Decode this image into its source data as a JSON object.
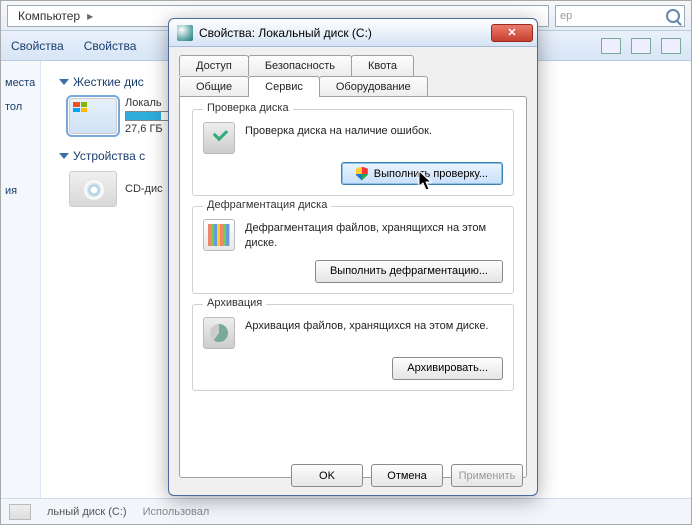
{
  "explorer": {
    "breadcrumb_root": "Компьютер",
    "search_placeholder": "ер",
    "toolbar": {
      "props1": "Свойства",
      "props2": "Свойства"
    },
    "section_hdd": "Жесткие дис",
    "section_removable": "Устройства с",
    "drive_c": {
      "label": "Локаль",
      "free": "27,6 ГБ"
    },
    "drive_cd": {
      "label": "CD-дис"
    },
    "status_prefix": "льный диск (C:)",
    "status_used": "Использовал"
  },
  "dialog": {
    "title": "Свойства: Локальный диск (C:)",
    "tabs": {
      "access": "Доступ",
      "security": "Безопасность",
      "quota": "Квота",
      "general": "Общие",
      "service": "Сервис",
      "hardware": "Оборудование"
    },
    "check": {
      "legend": "Проверка диска",
      "text": "Проверка диска на наличие ошибок.",
      "button": "Выполнить проверку..."
    },
    "defrag": {
      "legend": "Дефрагментация диска",
      "text": "Дефрагментация файлов, хранящихся на этом диске.",
      "button": "Выполнить дефрагментацию..."
    },
    "backup": {
      "legend": "Архивация",
      "text": "Архивация файлов, хранящихся на этом диске.",
      "button": "Архивировать..."
    },
    "buttons": {
      "ok": "OK",
      "cancel": "Отмена",
      "apply": "Применить"
    }
  },
  "sidebar": {
    "places": "места",
    "desktop": "тол",
    "recent": "ия"
  }
}
